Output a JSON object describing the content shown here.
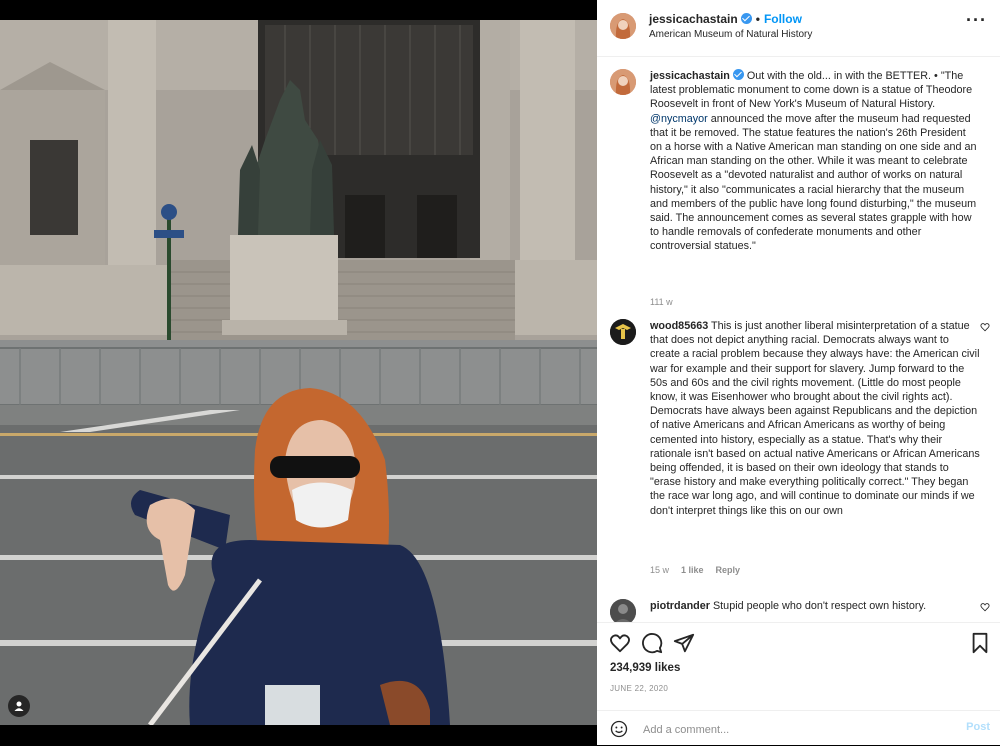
{
  "post": {
    "author": "jessicachastain",
    "follow_label": "Follow",
    "location": "American Museum of Natural History"
  },
  "caption": {
    "username": "jessicachastain",
    "text_before_mention": "Out with the old... in with the BETTER. • \"The latest problematic monument to come down is a statue of Theodore Roosevelt in front of New York's Museum of Natural History. ",
    "mention": "@nycmayor",
    "text_after_mention": " announced the move after the museum had requested that it be removed. The statue features the nation's 26th President on a horse with a Native American man standing on one side and an African man standing on the other. While it was meant to celebrate Roosevelt as a \"devoted naturalist and author of works on natural history,\" it also \"communicates a racial hierarchy that the museum and members of the public have long found disturbing,\" the museum said. The announcement comes as several states grapple with how to handle removals of confederate monuments and other controversial statues.\"",
    "age": "111 w"
  },
  "comments": [
    {
      "username": "wood85663",
      "text": "This is just another liberal misinterpretation of a statue that does not depict anything racial. Democrats always want to create a racial problem because they always have: the American civil war for example and their support for slavery. Jump forward to the 50s and 60s and the civil rights movement. (Little do most people know, it was Eisenhower who brought about the civil rights act). Democrats have always been against Republicans and the depiction of native Americans and African Americans as worthy of being cemented into history, especially as a statue. That's why their rationale isn't based on actual native Americans or African Americans being offended, it is based on their own ideology that stands to \"erase history and make everything politically correct.\" They began the race war long ago, and will continue to dominate our minds if we don't interpret things like this on our own",
      "age": "15 w",
      "likes": "1 like",
      "reply": "Reply"
    },
    {
      "username": "piotrdander",
      "text": "Stupid people who don't respect own history."
    }
  ],
  "engagement": {
    "likes": "234,939 likes",
    "date": "JUNE 22, 2020"
  },
  "composer": {
    "placeholder": "Add a comment...",
    "post_label": "Post"
  },
  "icons": {
    "verified": "verified-badge-icon",
    "more": "more-options-icon",
    "like": "heart-icon",
    "comment": "comment-bubble-icon",
    "share": "paper-plane-icon",
    "save": "bookmark-icon",
    "emoji": "emoji-smiley-icon",
    "user_tag": "user-tag-icon"
  },
  "colors": {
    "accent": "#0095f6",
    "verified": "#3897f0",
    "muted": "#8e8e8e",
    "mention": "#00376b"
  }
}
